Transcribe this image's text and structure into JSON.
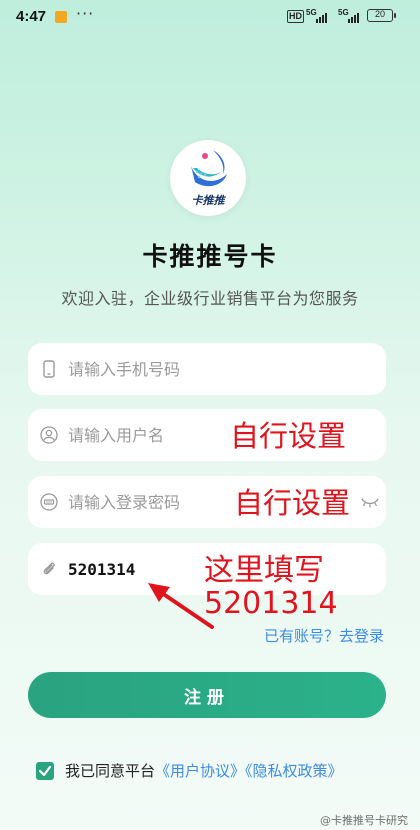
{
  "status_bar": {
    "time": "4:47",
    "more": "···",
    "hd": "HD",
    "network_1": "5G",
    "network_2": "5G",
    "battery": "20"
  },
  "logo": {
    "text": "卡推推"
  },
  "header": {
    "title": "卡推推号卡",
    "subtitle": "欢迎入驻，企业级行业销售平台为您服务"
  },
  "form": {
    "phone": {
      "placeholder": "请输入手机号码",
      "value": ""
    },
    "username": {
      "placeholder": "请输入用户名",
      "value": ""
    },
    "password": {
      "placeholder": "请输入登录密码",
      "value": ""
    },
    "invite": {
      "placeholder": "",
      "value": "5201314"
    },
    "login_link": "已有账号？去登录",
    "register_label": "注册"
  },
  "agreement": {
    "checked": true,
    "prefix": "我已同意平台",
    "user_agreement": "《用户协议》",
    "privacy_policy": "《隐私权政策》"
  },
  "annotations": {
    "username_note": "自行设置",
    "password_note": "自行设置",
    "invite_note_line1": "这里填写",
    "invite_note_line2": "5201314"
  },
  "watermark": "@卡推推号卡研究",
  "colors": {
    "accent": "#2aa37f",
    "link": "#3c8ce7",
    "annotation": "#e0141d"
  }
}
